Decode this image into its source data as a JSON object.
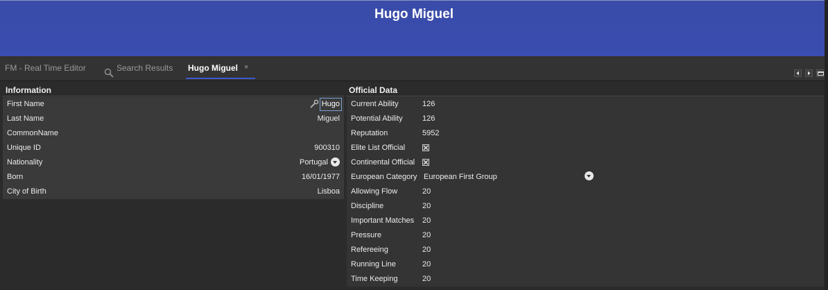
{
  "header": {
    "title": "Hugo Miguel"
  },
  "tabs": {
    "fm_label": "FM - Real Time Editor",
    "search_label": "Search Results",
    "player_label": "Hugo Miguel",
    "close_glyph": "×"
  },
  "information": {
    "title": "Information",
    "rows": [
      {
        "label": "First Name",
        "value": "Hugo"
      },
      {
        "label": "Last Name",
        "value": "Miguel"
      },
      {
        "label": "CommonName",
        "value": ""
      },
      {
        "label": "Unique ID",
        "value": "900310"
      },
      {
        "label": "Nationality",
        "value": "Portugal"
      },
      {
        "label": "Born",
        "value": "16/01/1977"
      },
      {
        "label": "City of Birth",
        "value": "Lisboa"
      }
    ]
  },
  "official": {
    "title": "Official Data",
    "rows": [
      {
        "label": "Current Ability",
        "value": "126"
      },
      {
        "label": "Potential Ability",
        "value": "126"
      },
      {
        "label": "Reputation",
        "value": "5952"
      },
      {
        "label": "Elite List Official",
        "checked": true
      },
      {
        "label": "Continental Official",
        "checked": true
      },
      {
        "label": "European Category",
        "value": "European First Group"
      },
      {
        "label": "Allowing Flow",
        "value": "20"
      },
      {
        "label": "Discipline",
        "value": "20"
      },
      {
        "label": "Important Matches",
        "value": "20"
      },
      {
        "label": "Pressure",
        "value": "20"
      },
      {
        "label": "Refereeing",
        "value": "20"
      },
      {
        "label": "Running Line",
        "value": "20"
      },
      {
        "label": "Time Keeping",
        "value": "20"
      }
    ]
  },
  "icons": {
    "search": "search-icon",
    "pick": "picker-icon",
    "dropdown": "chevron-down-icon",
    "checkbox": "checkbox-x-icon"
  },
  "colors": {
    "header_bg": "#3a4db0",
    "accent": "#3d5ad1",
    "background": "#2b2b2b"
  }
}
